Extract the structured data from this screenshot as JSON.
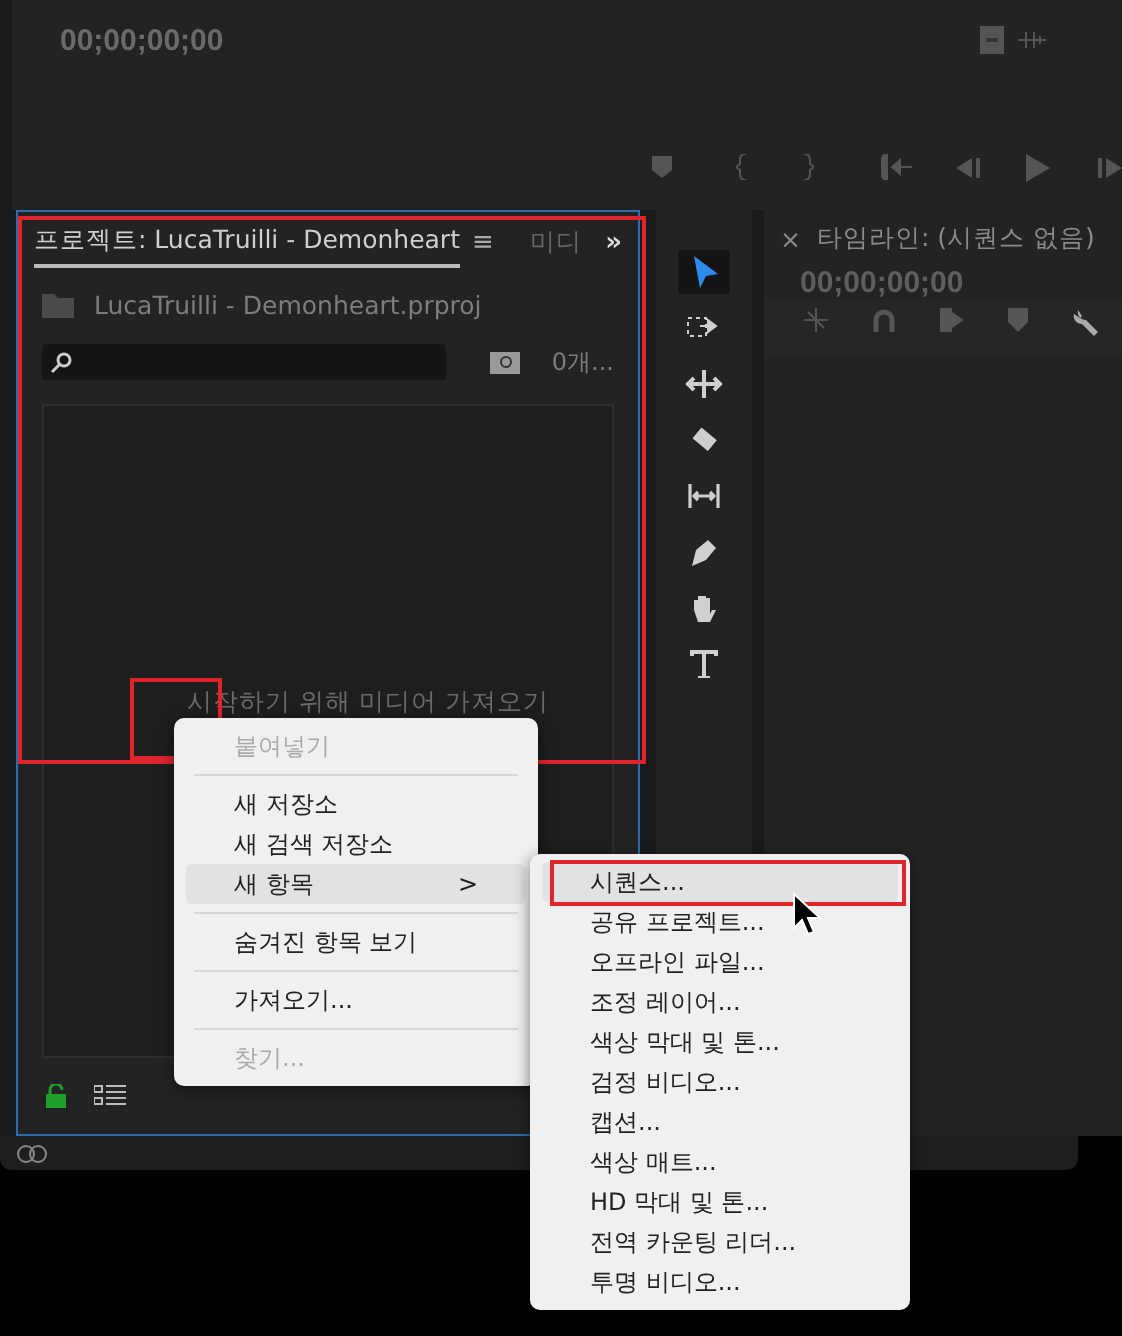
{
  "monitor": {
    "timecode": "00;00;00;00"
  },
  "project_panel": {
    "tab_label": "프로젝트: LucaTruilli - Demonheart",
    "menu_glyph": "≡",
    "next_tab": "미디",
    "overflow_glyph": "»",
    "file_name": "LucaTruilli - Demonheart.prproj",
    "item_count": "0개...",
    "empty_hint": "시작하기 위해 미디어 가져오기"
  },
  "tools": [
    {
      "kind": "select",
      "selected": true
    },
    {
      "kind": "track",
      "selected": false
    },
    {
      "kind": "ripple",
      "selected": false
    },
    {
      "kind": "razor",
      "selected": false
    },
    {
      "kind": "slip",
      "selected": false
    },
    {
      "kind": "pen",
      "selected": false
    },
    {
      "kind": "hand",
      "selected": false
    },
    {
      "kind": "type",
      "selected": false
    }
  ],
  "timeline": {
    "close_glyph": "×",
    "tab_label": "타임라인: (시퀀스 없음)",
    "timecode": "00;00;00;00"
  },
  "context_menu": [
    {
      "kind": "item",
      "label": "붙여넣기",
      "disabled": true,
      "selected": false
    },
    {
      "kind": "separator"
    },
    {
      "kind": "item",
      "label": "새 저장소",
      "disabled": false,
      "selected": false
    },
    {
      "kind": "item",
      "label": "새 검색 저장소",
      "disabled": false,
      "selected": false
    },
    {
      "kind": "submenu",
      "label": "새 항목",
      "arrow": ">",
      "disabled": false,
      "selected": true
    },
    {
      "kind": "separator"
    },
    {
      "kind": "item",
      "label": "숨겨진 항목 보기",
      "disabled": false,
      "selected": false
    },
    {
      "kind": "separator"
    },
    {
      "kind": "item",
      "label": "가져오기...",
      "disabled": false,
      "selected": false
    },
    {
      "kind": "separator"
    },
    {
      "kind": "item",
      "label": "찾기...",
      "disabled": true,
      "selected": false
    }
  ],
  "submenu": [
    {
      "label": "시퀀스...",
      "selected": true
    },
    {
      "label": "공유 프로젝트...",
      "selected": false
    },
    {
      "label": "오프라인 파일...",
      "selected": false
    },
    {
      "label": "조정 레이어...",
      "selected": false
    },
    {
      "label": "색상 막대 및 톤...",
      "selected": false
    },
    {
      "label": "검정 비디오...",
      "selected": false
    },
    {
      "label": "캡션...",
      "selected": false
    },
    {
      "label": "색상 매트...",
      "selected": false
    },
    {
      "label": "HD 막대 및 톤...",
      "selected": false
    },
    {
      "label": "전역 카운팅 리더...",
      "selected": false
    },
    {
      "label": "투명 비디오...",
      "selected": false
    }
  ]
}
